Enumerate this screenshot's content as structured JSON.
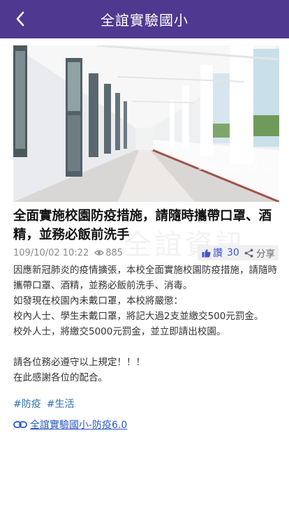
{
  "header": {
    "title": "全誼實驗國小",
    "back_icon": "chevron-left-icon",
    "background_color": "#4f3890"
  },
  "post": {
    "image_timestamp": "109/10/02 10:22",
    "title": "全面實施校園防疫措施，請隨時攜帶口罩、酒精，並務必飯前洗手",
    "date": "109/10/02 10:22",
    "views": "885",
    "likes_label": "讚",
    "likes_count": "30",
    "share_label": "分享",
    "watermark": "全誼資訊",
    "body": [
      "因應新冠肺炎的疫情擴張，本校全面實施校園防疫措施，請隨時攜帶口罩、酒精，並務必飯前洗手、消毒。",
      "如發現在校園內未戴口罩，本校將嚴懲：",
      "校內人士、學生未戴口罩，將記大過2支並繳交500元罰金。",
      "校外人士，將繳交5000元罰金，並立即請出校園。",
      "",
      "請各位務必遵守以上規定！！！",
      "在此感謝各位的配合。"
    ],
    "tags": [
      "#防疫",
      "#生活"
    ],
    "link_text": "全誼實驗國小-防疫6.0"
  }
}
